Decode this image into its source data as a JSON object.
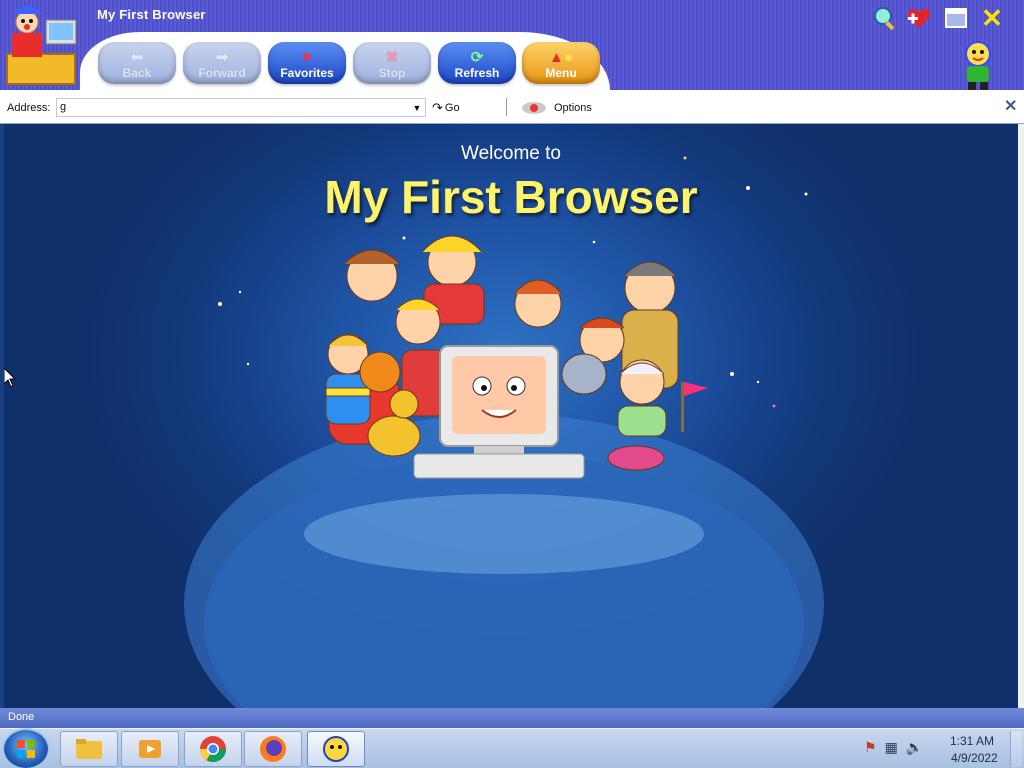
{
  "window": {
    "title": "My First Browser"
  },
  "toolbar": {
    "back_label": "Back",
    "forward_label": "Forward",
    "favorites_label": "Favorites",
    "stop_label": "Stop",
    "refresh_label": "Refresh",
    "menu_label": "Menu"
  },
  "address_bar": {
    "label": "Address:",
    "value": "g",
    "go_label": "Go",
    "options_label": "Options"
  },
  "content": {
    "welcome_text": "Welcome to",
    "headline": "My First Browser"
  },
  "status_bar": {
    "text": "Done"
  },
  "taskbar": {
    "apps": [
      "windows-explorer",
      "media-player",
      "chrome",
      "firefox",
      "my-first-browser"
    ],
    "clock_time": "1:31 AM",
    "clock_date": "4/9/2022"
  },
  "colors": {
    "titlebar_purple": "#5b5bd6",
    "content_blue": "#1d4f9f",
    "headline_yellow": "#fff36a",
    "status_blue": "#5f79cc"
  }
}
